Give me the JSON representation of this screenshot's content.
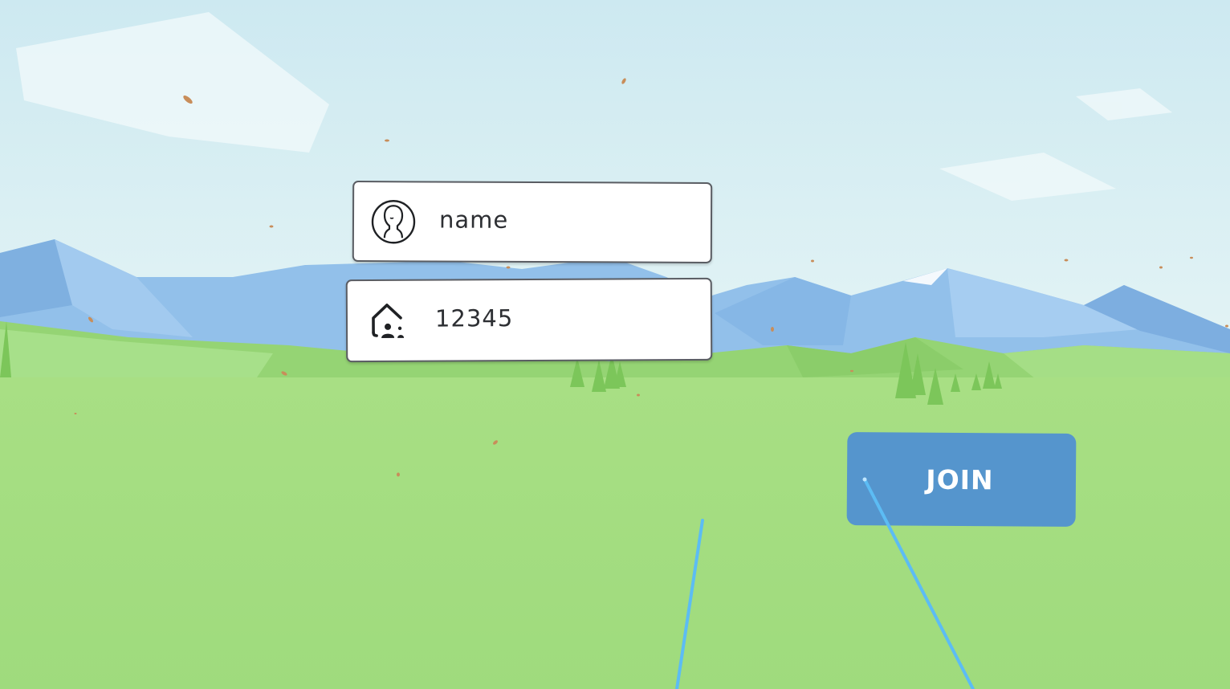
{
  "scene": {
    "sky_color_top": "#cfeaf1",
    "sky_color_bottom": "#e4f4f6",
    "ground_color": "#a0dc7c",
    "mountain_color": "#8fbde9",
    "pointer_ray_color": "#5cbcf4"
  },
  "form": {
    "name_field": {
      "icon": "user-avatar-icon",
      "value": "name"
    },
    "room_field": {
      "icon": "house-people-icon",
      "value": "12345"
    },
    "join_button": {
      "label": "JOIN",
      "color": "#5595cd"
    }
  }
}
